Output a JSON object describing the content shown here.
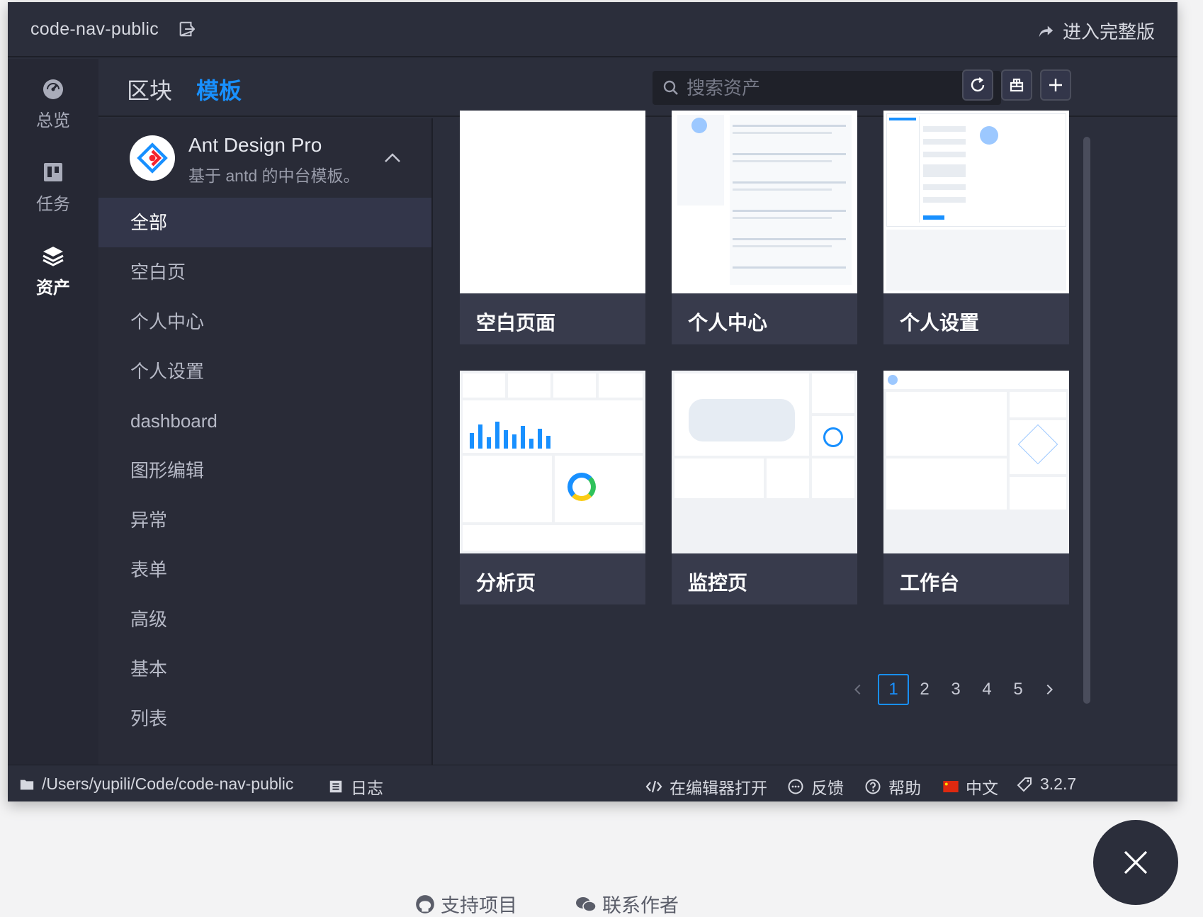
{
  "window": {
    "title": "code-nav-public",
    "full_version": "进入完整版"
  },
  "rail": [
    {
      "label": "总览",
      "icon": "dashboard-icon"
    },
    {
      "label": "任务",
      "icon": "trello-board-icon"
    },
    {
      "label": "资产",
      "icon": "layers-icon"
    }
  ],
  "tabs": [
    {
      "label": "区块"
    },
    {
      "label": "模板"
    }
  ],
  "search": {
    "placeholder": "搜索资产"
  },
  "library": {
    "name": "Ant Design Pro",
    "description": "基于 antd 的中台模板。"
  },
  "categories": [
    "全部",
    "空白页",
    "个人中心",
    "个人设置",
    "dashboard",
    "图形编辑",
    "异常",
    "表单",
    "高级",
    "基本",
    "列表"
  ],
  "templates": [
    "空白页面",
    "个人中心",
    "个人设置",
    "分析页",
    "监控页",
    "工作台"
  ],
  "pagination": {
    "pages": [
      "1",
      "2",
      "3",
      "4",
      "5"
    ],
    "current": "1"
  },
  "status": {
    "path": "/Users/yupili/Code/code-nav-public",
    "log": "日志",
    "open_editor": "在编辑器打开",
    "feedback": "反馈",
    "help": "帮助",
    "language": "中文",
    "version": "3.2.7"
  },
  "footer": {
    "support": "支持项目",
    "contact": "联系作者"
  },
  "colors": {
    "accent": "#1890ff",
    "window_bg": "#2b2e3b",
    "page_bg": "#f3f3f4"
  }
}
